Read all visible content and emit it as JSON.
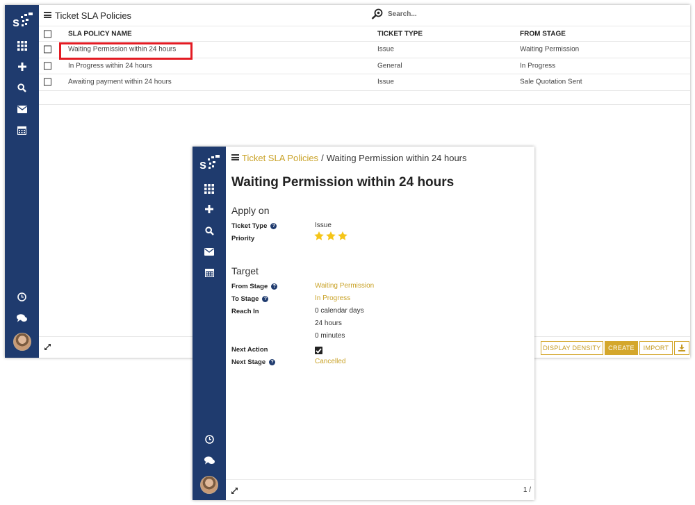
{
  "list_view": {
    "title": "Ticket SLA Policies",
    "search_placeholder": "Search...",
    "columns": [
      "SLA POLICY NAME",
      "TICKET TYPE",
      "FROM STAGE"
    ],
    "rows": [
      {
        "name": "Waiting Permission within 24 hours",
        "ticket_type": "Issue",
        "from_stage": "Waiting Permission"
      },
      {
        "name": "In Progress within 24 hours",
        "ticket_type": "General",
        "from_stage": "In Progress"
      },
      {
        "name": "Awaiting payment within 24 hours",
        "ticket_type": "Issue",
        "from_stage": "Sale Quotation Sent"
      }
    ],
    "buttons": {
      "display_density": "DISPLAY DENSITY",
      "create": "CREATE",
      "import": "IMPORT"
    }
  },
  "form_view": {
    "breadcrumb_parent": "Ticket SLA Policies",
    "breadcrumb_separator": "/",
    "breadcrumb_current": "Waiting Permission within 24 hours",
    "title": "Waiting Permission within 24 hours",
    "apply_on": {
      "heading": "Apply on",
      "ticket_type_label": "Ticket Type",
      "ticket_type_value": "Issue",
      "priority_label": "Priority",
      "priority_stars": 3
    },
    "target": {
      "heading": "Target",
      "from_stage_label": "From Stage",
      "from_stage_value": "Waiting Permission",
      "to_stage_label": "To Stage",
      "to_stage_value": "In Progress",
      "reach_in_label": "Reach In",
      "reach_days": "0 calendar days",
      "reach_hours": "24 hours",
      "reach_minutes": "0 minutes",
      "next_action_label": "Next Action",
      "next_action_checked": true,
      "next_stage_label": "Next Stage",
      "next_stage_value": "Cancelled"
    },
    "pager": "1 /",
    "help_glyph": "?"
  },
  "colors": {
    "sidebar": "#1f3b6e",
    "accent": "#d4a72c",
    "link": "#c9a227",
    "highlight": "#e31b23",
    "callout": "#ff9a9a"
  },
  "icons": [
    "logo-icon",
    "apps-grid-icon",
    "plus-icon",
    "search-icon",
    "envelope-icon",
    "calendar-icon",
    "clock-icon",
    "chat-icon",
    "expand-icon",
    "download-icon",
    "search-magnifier-icon"
  ]
}
